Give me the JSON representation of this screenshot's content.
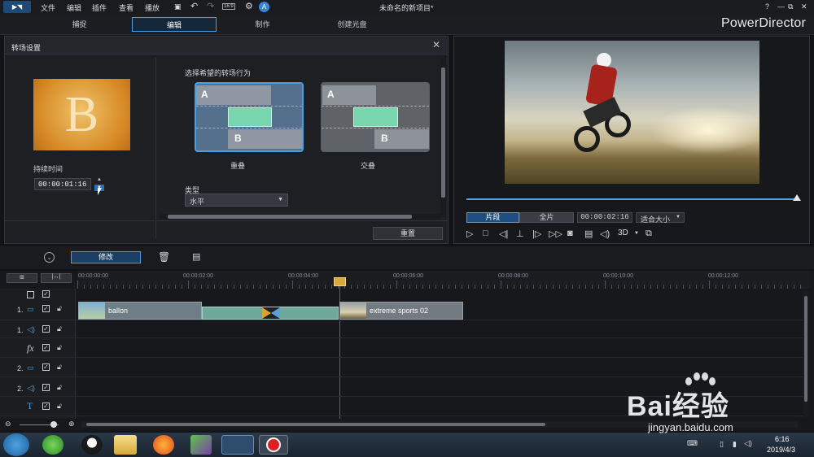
{
  "menubar": {
    "items": [
      "文件",
      "编辑",
      "插件",
      "查看",
      "播放"
    ],
    "title": "未命名的新项目*",
    "window_controls": [
      "?",
      "—",
      "⧉",
      "✕"
    ]
  },
  "tabs": [
    "捕捉",
    "编辑",
    "制作",
    "创建光盘"
  ],
  "brand": "PowerDirector",
  "transition_panel": {
    "title": "转场设置",
    "thumbnail_letter": "B",
    "duration_label": "持续时间",
    "duration_value": "00:00:01:16",
    "behavior_label": "选择希望的转场行为",
    "options": [
      {
        "label": "重叠",
        "selected": true
      },
      {
        "label": "交叠",
        "selected": false
      }
    ],
    "type_label": "类型",
    "type_value": "水平",
    "reset_button": "重置"
  },
  "preview": {
    "mode_clip": "片段",
    "mode_full": "全片",
    "time": "00:00:02:16",
    "fit": "适合大小",
    "threed": "3D",
    "progress": 0.99
  },
  "timeline_toolbar": {
    "modify_button": "修改"
  },
  "ruler": {
    "ticks": [
      "00:00:00:00",
      "00:00:02:00",
      "00:00:04:00",
      "00:00:06:00",
      "00:00:08:00",
      "00:00:10:00",
      "00:00:12:00"
    ]
  },
  "tracks": {
    "labels": [
      "1.",
      "1.",
      "fx",
      "2.",
      "2.",
      "T"
    ],
    "clip1": "ballon",
    "clip2": "extreme sports 02"
  },
  "taskbar": {
    "time": "6:16",
    "date": "2019/4/3"
  },
  "watermark": {
    "text": "Bai经验",
    "url": "jingyan.baidu.com"
  },
  "colors": {
    "accent": "#4a9fe0",
    "clip_green": "#7fd1ad",
    "playhead": "#d0342c"
  }
}
